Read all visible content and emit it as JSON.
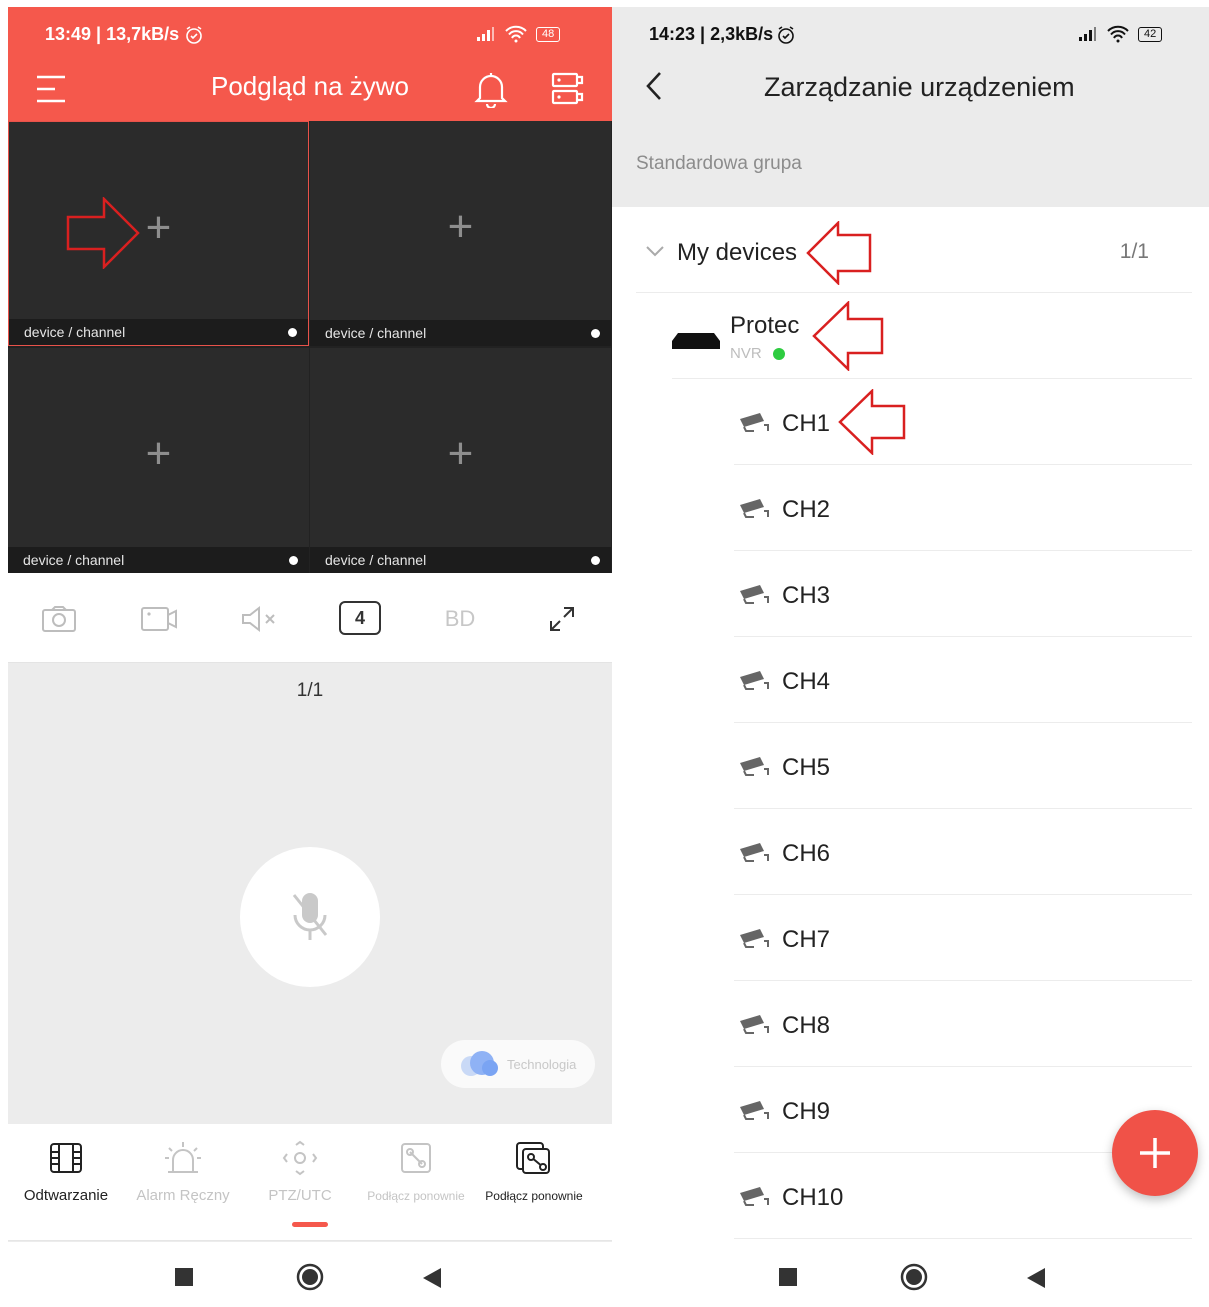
{
  "left": {
    "status": {
      "time": "13:49 | 13,7kB/s",
      "battery": "48"
    },
    "header": {
      "title": "Podgląd na żywo"
    },
    "cells": [
      {
        "caption": "device / channel"
      },
      {
        "caption": "device / channel"
      },
      {
        "caption": "device / channel"
      },
      {
        "caption": "device / channel"
      }
    ],
    "toolbar": {
      "split_count": "4",
      "quality": "BD"
    },
    "page": "1/1",
    "tech_badge": "Technologia",
    "nav": [
      {
        "label": "Odtwarzanie",
        "icon": "film-icon"
      },
      {
        "label": "Alarm Ręczny",
        "icon": "alarm-icon"
      },
      {
        "label": "PTZ/UTC",
        "icon": "ptz-icon"
      },
      {
        "label": "Podłącz ponownie",
        "icon": "reconnect-icon"
      },
      {
        "label": "Podłącz ponownie",
        "icon": "reconnect-multi-icon"
      }
    ]
  },
  "right": {
    "status": {
      "time": "14:23 | 2,3kB/s",
      "battery": "42"
    },
    "header": {
      "title": "Zarządzanie urządzeniem"
    },
    "group": "Standardowa grupa",
    "my_devices": {
      "label": "My devices",
      "count": "1/1"
    },
    "device": {
      "name": "Protec",
      "type": "NVR"
    },
    "channels": [
      "CH1",
      "CH2",
      "CH3",
      "CH4",
      "CH5",
      "CH6",
      "CH7",
      "CH8",
      "CH9",
      "CH10"
    ]
  },
  "colors": {
    "accent": "#f5584c",
    "annotation": "#d92020",
    "online": "#2ecc40"
  }
}
